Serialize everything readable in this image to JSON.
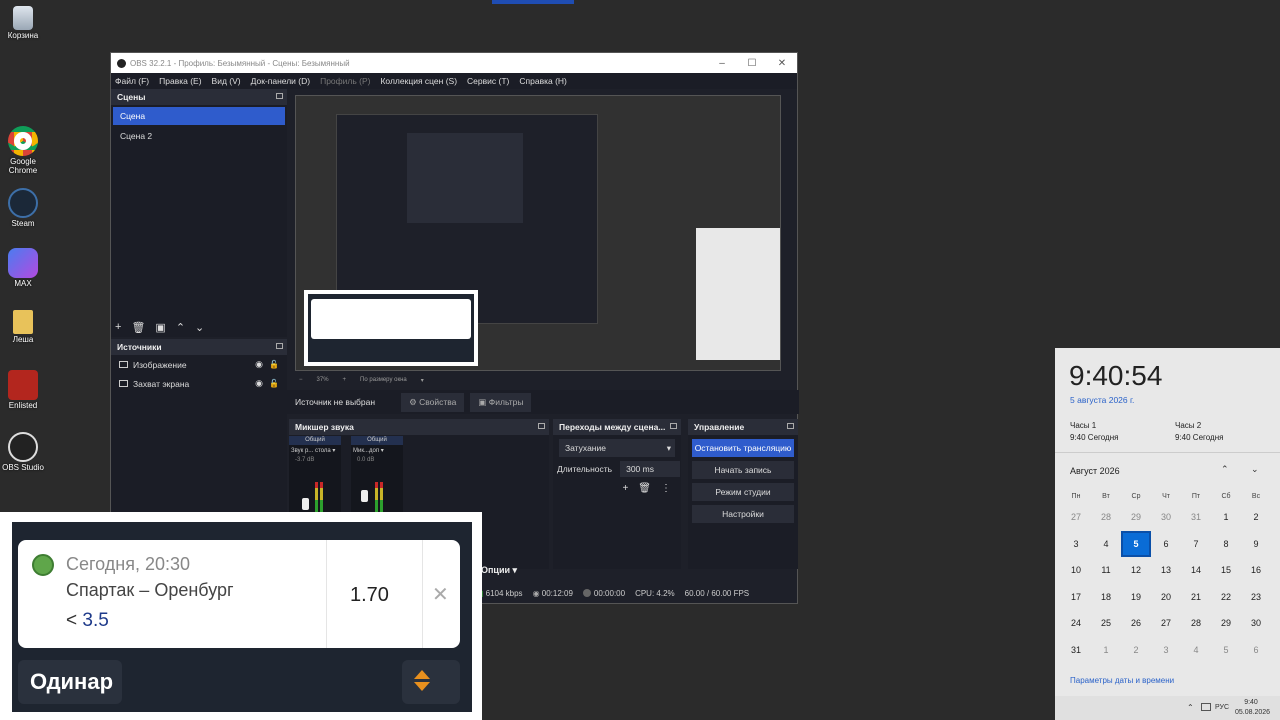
{
  "desktop": {
    "icons": [
      {
        "label": "Корзина"
      },
      {
        "label": "Google Chrome"
      },
      {
        "label": "Steam"
      },
      {
        "label": "MAX"
      },
      {
        "label": "Леша"
      },
      {
        "label": "Enlisted"
      },
      {
        "label": "OBS Studio"
      }
    ]
  },
  "obs": {
    "title": "OBS 32.2.1 - Профиль: Безымянный - Сцены: Безымянный",
    "menu": [
      "Файл (F)",
      "Правка (E)",
      "Вид (V)",
      "Док-панели (D)",
      "Профиль (P)",
      "Коллекция сцен (S)",
      "Сервис (T)",
      "Справка (H)"
    ],
    "scenes_header": "Сцены",
    "scenes": [
      "Сцена",
      "Сцена 2"
    ],
    "sources_header": "Источники",
    "sources": [
      "Изображение",
      "Захват экрана"
    ],
    "zoom": "37%",
    "fit": "По размеру окна",
    "no_source": "Источник не выбран",
    "properties_btn": "Свойства",
    "filters_btn": "Фильтры",
    "mixer_header": "Микшер звука",
    "mixer_channels": [
      {
        "bus": "Общий",
        "name": "Звук р... стола",
        "db": "-3.7 dB"
      },
      {
        "bus": "Общий",
        "name": "Мик...доп",
        "db": "0.0 dB"
      }
    ],
    "transitions_header": "Переходы между сцена...",
    "transition": "Затухание",
    "duration_label": "Длительность",
    "duration_value": "300 ms",
    "controls_header": "Управление",
    "controls": [
      "Остановить трансляцию",
      "Начать запись",
      "Режим студии",
      "Настройки"
    ],
    "options": "Опции",
    "status": {
      "bitrate": "6104 kbps",
      "stream_time": "00:12:09",
      "rec_time": "00:00:00",
      "cpu": "CPU: 4.2%",
      "fps": "60.00 / 60.00 FPS"
    }
  },
  "bet": {
    "time": "Сегодня, 20:30",
    "match": "Спартак – Оренбург",
    "line_prefix": "<",
    "line_value": "3.5",
    "odds": "1.70",
    "type": "Одинар"
  },
  "clock": {
    "time": "9:40:54",
    "date": "5 августа 2026 г.",
    "clocks": [
      {
        "name": "Часы 1",
        "value": "9:40 Сегодня"
      },
      {
        "name": "Часы 2",
        "value": "9:40 Сегодня"
      }
    ],
    "month": "Август 2026",
    "weekdays": [
      "Пн",
      "Вт",
      "Ср",
      "Чт",
      "Пт",
      "Сб",
      "Вс"
    ],
    "settings": "Параметры даты и времени"
  },
  "tray": {
    "lang": "РУС",
    "time": "9:40",
    "date": "05.08.2026"
  }
}
